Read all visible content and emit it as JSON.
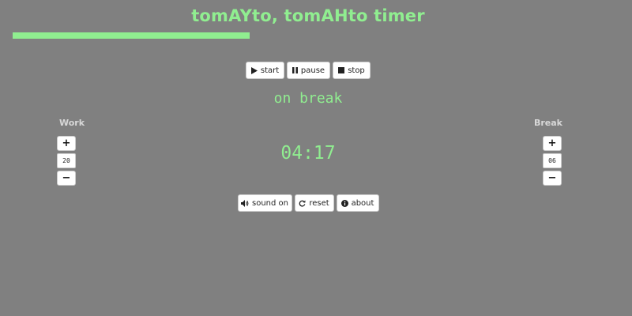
{
  "app": {
    "title": "tomAYto, tomAHto timer",
    "accent_color": "#90ee90",
    "background_color": "#808080"
  },
  "progress": {
    "fraction": 0.375
  },
  "controls": {
    "start": {
      "label": "start",
      "icon": "play-icon"
    },
    "pause": {
      "label": "pause",
      "icon": "pause-icon"
    },
    "stop": {
      "label": "stop",
      "icon": "stop-icon"
    }
  },
  "status": {
    "text": "on break"
  },
  "timer": {
    "display": "04:17"
  },
  "work": {
    "label": "Work",
    "value": "20",
    "increment_label": "+",
    "decrement_label": "−"
  },
  "break": {
    "label": "Break",
    "value": "06",
    "increment_label": "+",
    "decrement_label": "−"
  },
  "bottom": {
    "sound": {
      "label": "sound on",
      "icon": "volume-icon"
    },
    "reset": {
      "label": "reset",
      "icon": "refresh-icon"
    },
    "about": {
      "label": "about",
      "icon": "info-icon"
    }
  }
}
